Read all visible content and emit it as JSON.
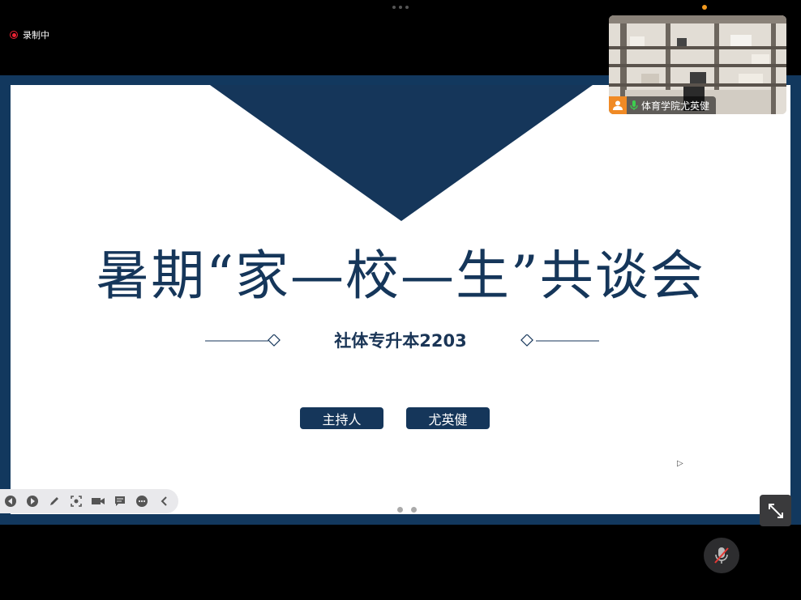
{
  "recording": {
    "label": "录制中"
  },
  "slide": {
    "title": "暑期“家—校—生”共谈会",
    "subtitle": "社体专升本2203",
    "host_label": "主持人",
    "host_name": "尤英健",
    "page_indicator": {
      "pages": 2
    }
  },
  "participant": {
    "name": "体育学院尤英健"
  },
  "toolbar": {
    "items": [
      "prev-icon",
      "play-icon",
      "pen-icon",
      "screenshot-icon",
      "camera-icon",
      "chat-icon",
      "more-icon",
      "collapse-icon"
    ]
  },
  "colors": {
    "navy": "#15365a",
    "frame": "#12385e",
    "accent_orange": "#f08a25",
    "record_red": "#e23"
  }
}
